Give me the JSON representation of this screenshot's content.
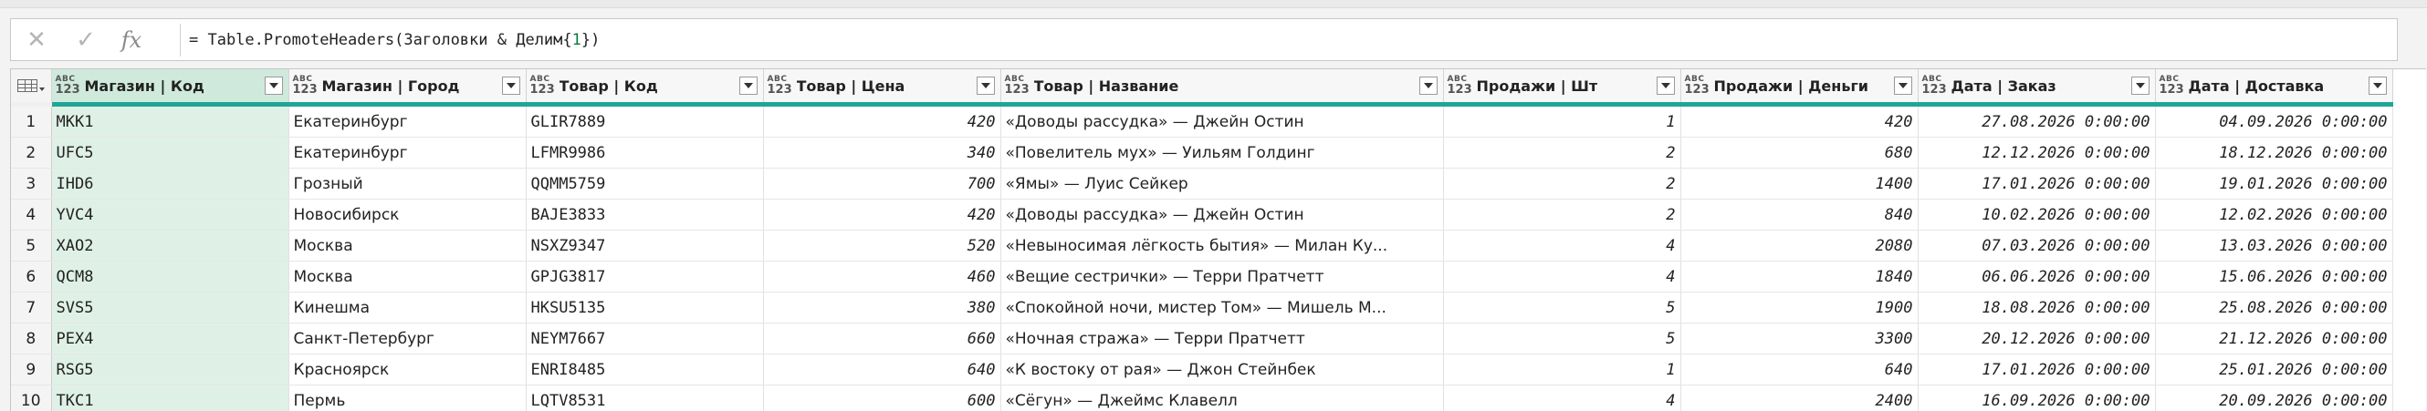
{
  "formula_bar": {
    "cancel_icon": "cancel-icon",
    "confirm_icon": "check-icon",
    "fx_label": "fx",
    "formula_prefix": "= Table.PromoteHeaders(Заголовки & Делим{",
    "formula_index": "1",
    "formula_suffix": "})"
  },
  "columns": [
    {
      "type_top": "ABC",
      "type_bottom": "123",
      "name": "Магазин | Код"
    },
    {
      "type_top": "ABC",
      "type_bottom": "123",
      "name": "Магазин | Город"
    },
    {
      "type_top": "ABC",
      "type_bottom": "123",
      "name": "Товар | Код"
    },
    {
      "type_top": "ABC",
      "type_bottom": "123",
      "name": "Товар | Цена"
    },
    {
      "type_top": "ABC",
      "type_bottom": "123",
      "name": "Товар | Название"
    },
    {
      "type_top": "ABC",
      "type_bottom": "123",
      "name": "Продажи | Шт"
    },
    {
      "type_top": "ABC",
      "type_bottom": "123",
      "name": "Продажи | Деньги"
    },
    {
      "type_top": "ABC",
      "type_bottom": "123",
      "name": "Дата | Заказ"
    },
    {
      "type_top": "ABC",
      "type_bottom": "123",
      "name": "Дата | Доставка"
    }
  ],
  "rows": [
    {
      "n": "1",
      "c": [
        "MKK1",
        "Екатеринбург",
        "GLIR7889",
        "420",
        "«Доводы рассудка» — Джейн Остин",
        "1",
        "420",
        "27.08.2026 0:00:00",
        "04.09.2026 0:00:00"
      ]
    },
    {
      "n": "2",
      "c": [
        "UFC5",
        "Екатеринбург",
        "LFMR9986",
        "340",
        "«Повелитель мух» — Уильям Голдинг",
        "2",
        "680",
        "12.12.2026 0:00:00",
        "18.12.2026 0:00:00"
      ]
    },
    {
      "n": "3",
      "c": [
        "IHD6",
        "Грозный",
        "QQMM5759",
        "700",
        "«Ямы» — Луис Сейкер",
        "2",
        "1400",
        "17.01.2026 0:00:00",
        "19.01.2026 0:00:00"
      ]
    },
    {
      "n": "4",
      "c": [
        "YVC4",
        "Новосибирск",
        "BAJE3833",
        "420",
        "«Доводы рассудка» — Джейн Остин",
        "2",
        "840",
        "10.02.2026 0:00:00",
        "12.02.2026 0:00:00"
      ]
    },
    {
      "n": "5",
      "c": [
        "XAO2",
        "Москва",
        "NSXZ9347",
        "520",
        "«Невыносимая лёгкость бытия» — Милан Ку...",
        "4",
        "2080",
        "07.03.2026 0:00:00",
        "13.03.2026 0:00:00"
      ]
    },
    {
      "n": "6",
      "c": [
        "QCM8",
        "Москва",
        "GPJG3817",
        "460",
        "«Вещие сестрички» — Терри Пратчетт",
        "4",
        "1840",
        "06.06.2026 0:00:00",
        "15.06.2026 0:00:00"
      ]
    },
    {
      "n": "7",
      "c": [
        "SVS5",
        "Кинешма",
        "HKSU5135",
        "380",
        "«Спокойной ночи, мистер Том» — Мишель М...",
        "5",
        "1900",
        "18.08.2026 0:00:00",
        "25.08.2026 0:00:00"
      ]
    },
    {
      "n": "8",
      "c": [
        "PEX4",
        "Санкт-Петербург",
        "NEYM7667",
        "660",
        "«Ночная стража» — Терри Пратчетт",
        "5",
        "3300",
        "20.12.2026 0:00:00",
        "21.12.2026 0:00:00"
      ]
    },
    {
      "n": "9",
      "c": [
        "RSG5",
        "Красноярск",
        "ENRI8485",
        "640",
        "«К востоку от рая» — Джон Стейнбек",
        "1",
        "640",
        "17.01.2026 0:00:00",
        "25.01.2026 0:00:00"
      ]
    },
    {
      "n": "10",
      "c": [
        "TKC1",
        "Пермь",
        "LQTV8531",
        "600",
        "«Сёгун» — Джеймс Клавелл",
        "4",
        "2400",
        "16.09.2026 0:00:00",
        "20.09.2026 0:00:00"
      ]
    }
  ],
  "colors": {
    "accent": "#20a596",
    "selected_column": "#cfeadd"
  }
}
